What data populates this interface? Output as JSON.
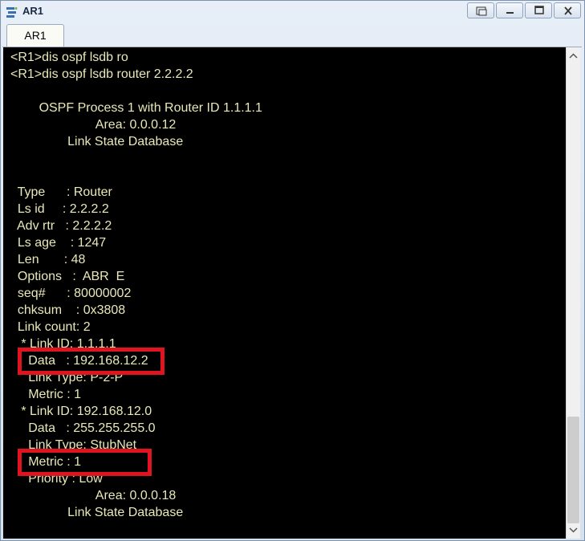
{
  "window": {
    "title": "AR1",
    "icon": "router-terminal-icon",
    "controls": [
      {
        "name": "restore-button",
        "icon": "restore-icon"
      },
      {
        "name": "minimize-button",
        "icon": "minimize-icon"
      },
      {
        "name": "maximize-button",
        "icon": "maximize-icon"
      },
      {
        "name": "close-button",
        "icon": "close-icon",
        "label": "X"
      }
    ]
  },
  "tabs": [
    {
      "label": "AR1",
      "active": true
    }
  ],
  "terminal": {
    "text_color": "#e8e8b8",
    "background": "#000000",
    "lines": [
      "<R1>dis ospf lsdb ro",
      "<R1>dis ospf lsdb router 2.2.2.2",
      "",
      "        OSPF Process 1 with Router ID 1.1.1.1",
      "                        Area: 0.0.0.12",
      "                Link State Database",
      "",
      "",
      "  Type      : Router",
      "  Ls id     : 2.2.2.2",
      "  Adv rtr   : 2.2.2.2",
      "  Ls age    : 1247",
      "  Len       : 48",
      "  Options   :  ABR  E",
      "  seq#      : 80000002",
      "  chksum    : 0x3808",
      "  Link count: 2",
      "   * Link ID: 1.1.1.1",
      "     Data   : 192.168.12.2",
      "     Link Type: P-2-P",
      "     Metric : 1",
      "   * Link ID: 192.168.12.0",
      "     Data   : 255.255.255.0",
      "     Link Type: StubNet",
      "     Metric : 1",
      "     Priority : Low",
      "                        Area: 0.0.0.18",
      "                Link State Database"
    ],
    "highlights": [
      {
        "label": "data-192.168.12.2",
        "line_index": 18,
        "color": "#e0141e"
      },
      {
        "label": "metric-1-stubnet",
        "line_index": 24,
        "color": "#e0141e"
      }
    ]
  },
  "scrollbar": {
    "position_fraction": 0.85
  }
}
